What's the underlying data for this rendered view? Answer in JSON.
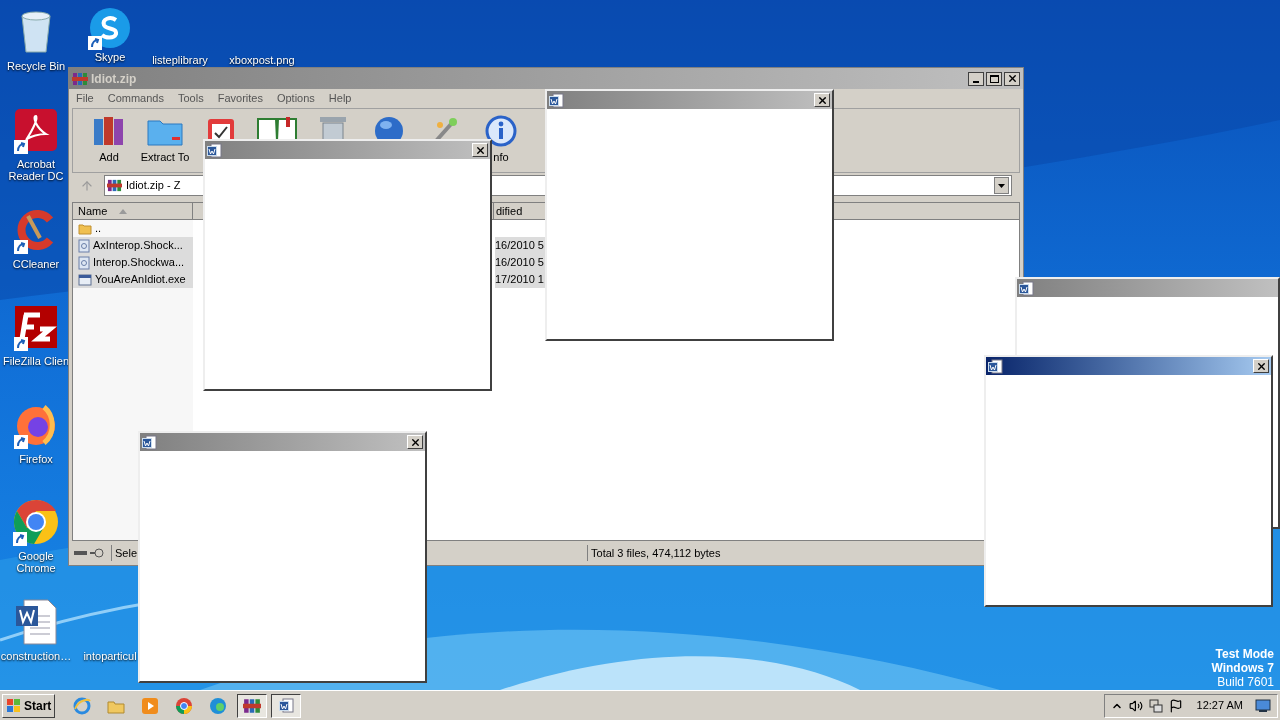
{
  "desktop_icons": [
    {
      "kind": "recycle",
      "label": "Recycle Bin",
      "shortcut": false
    },
    {
      "kind": "skype",
      "label": "Skype",
      "shortcut": true
    },
    {
      "kind": "hidden",
      "label": "listeplibrary"
    },
    {
      "kind": "hidden",
      "label": "xboxpost.png"
    },
    {
      "kind": "acrobat",
      "label": "Acrobat Reader DC",
      "shortcut": true
    },
    {
      "kind": "ccleaner",
      "label": "CCleaner",
      "shortcut": true
    },
    {
      "kind": "filezilla",
      "label": "FileZilla Clien",
      "shortcut": true
    },
    {
      "kind": "firefox",
      "label": "Firefox",
      "shortcut": true
    },
    {
      "kind": "chrome",
      "label": "Google Chrome",
      "shortcut": true
    },
    {
      "kind": "word",
      "label": "construction…",
      "shortcut": false
    },
    {
      "kind": "hidden",
      "label": "intoparticul"
    }
  ],
  "archive_window": {
    "title": "Idiot.zip",
    "menu": [
      "File",
      "Commands",
      "Tools",
      "Favorites",
      "Options",
      "Help"
    ],
    "toolbar": [
      {
        "kind": "add",
        "label": "Add"
      },
      {
        "kind": "extract",
        "label": "Extract To"
      },
      {
        "kind": "test"
      },
      {
        "kind": "view"
      },
      {
        "kind": "delete"
      },
      {
        "kind": "find"
      },
      {
        "kind": "wizard"
      },
      {
        "kind": "info",
        "label": "nfo"
      }
    ],
    "address": "Idiot.zip - Z",
    "columns": [
      "Name",
      "dified"
    ],
    "rows": [
      {
        "kind": "folder",
        "name": "..",
        "selected": false
      },
      {
        "kind": "file",
        "name": "AxInterop.Shock...",
        "modified": "16/2010 5",
        "selected": true
      },
      {
        "kind": "file",
        "name": "Interop.Shockwa...",
        "modified": "16/2010 5",
        "selected": true
      },
      {
        "kind": "exe",
        "name": "YouAreAnIdiot.exe",
        "modified": "17/2010 1",
        "selected": true
      }
    ],
    "status": [
      "Sele",
      "Total 3 files, 474,112 bytes"
    ]
  },
  "popups": [
    {
      "active": false,
      "close": true
    },
    {
      "active": false,
      "close": true
    },
    {
      "active": false,
      "close": false
    },
    {
      "active": true,
      "close": true
    },
    {
      "active": false,
      "close": true
    }
  ],
  "os_notice": [
    "Test Mode",
    "Windows 7",
    "Build 7601"
  ],
  "taskbar": {
    "start": "Start",
    "apps": [
      {
        "kind": "ie",
        "pressed": false
      },
      {
        "kind": "explorer",
        "pressed": false
      },
      {
        "kind": "media",
        "pressed": false
      },
      {
        "kind": "chrome",
        "pressed": false
      },
      {
        "kind": "edge",
        "pressed": false
      },
      {
        "kind": "winrar",
        "pressed": true
      },
      {
        "kind": "word",
        "pressed": true
      }
    ],
    "clock": "12:27 AM"
  }
}
